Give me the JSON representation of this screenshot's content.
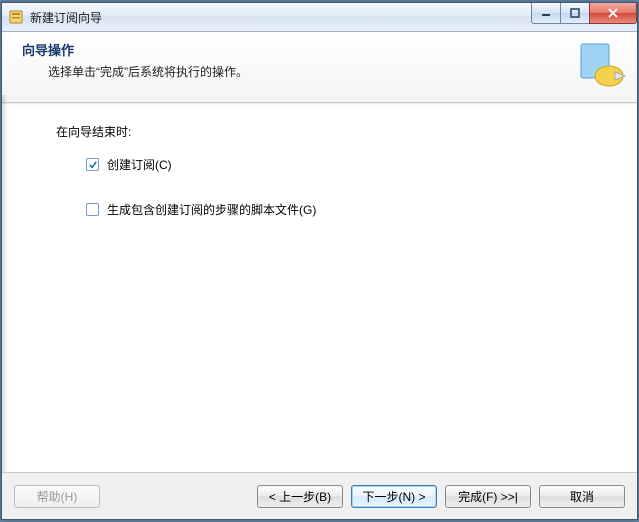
{
  "window": {
    "title": "新建订阅向导"
  },
  "header": {
    "title": "向导操作",
    "subtitle": "选择单击“完成”后系统将执行的操作。"
  },
  "body": {
    "intro": "在向导结束时:",
    "options": [
      {
        "label": "创建订阅(C)",
        "checked": true
      },
      {
        "label": "生成包含创建订阅的步骤的脚本文件(G)",
        "checked": false
      }
    ]
  },
  "footer": {
    "help": "帮助(H)",
    "back": "< 上一步(B)",
    "next": "下一步(N) >",
    "finish": "完成(F) >>|",
    "cancel": "取消"
  }
}
